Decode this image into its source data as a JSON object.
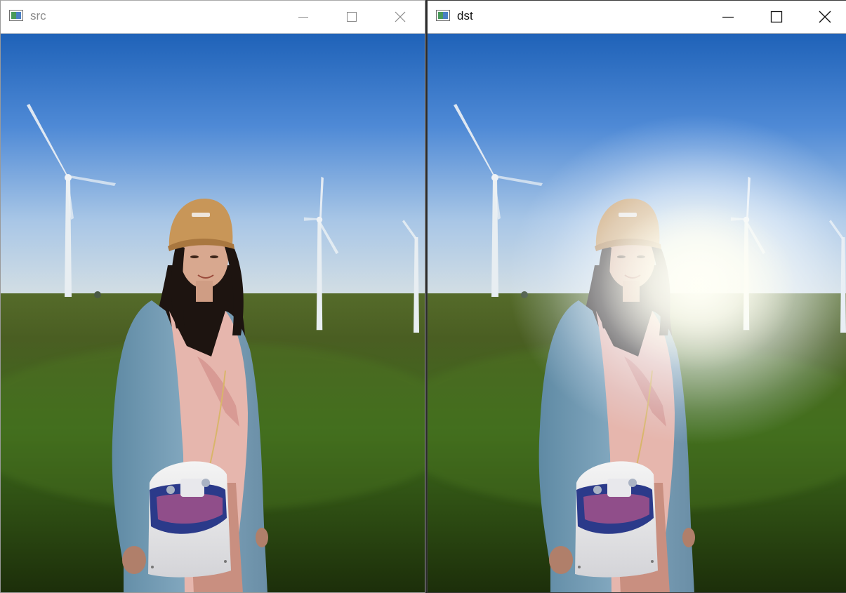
{
  "windows": [
    {
      "title": "src"
    },
    {
      "title": "dst"
    }
  ],
  "icons": {
    "app": "opencv-window-icon",
    "minimize": "minimize-icon",
    "maximize": "maximize-icon",
    "close": "close-icon"
  }
}
